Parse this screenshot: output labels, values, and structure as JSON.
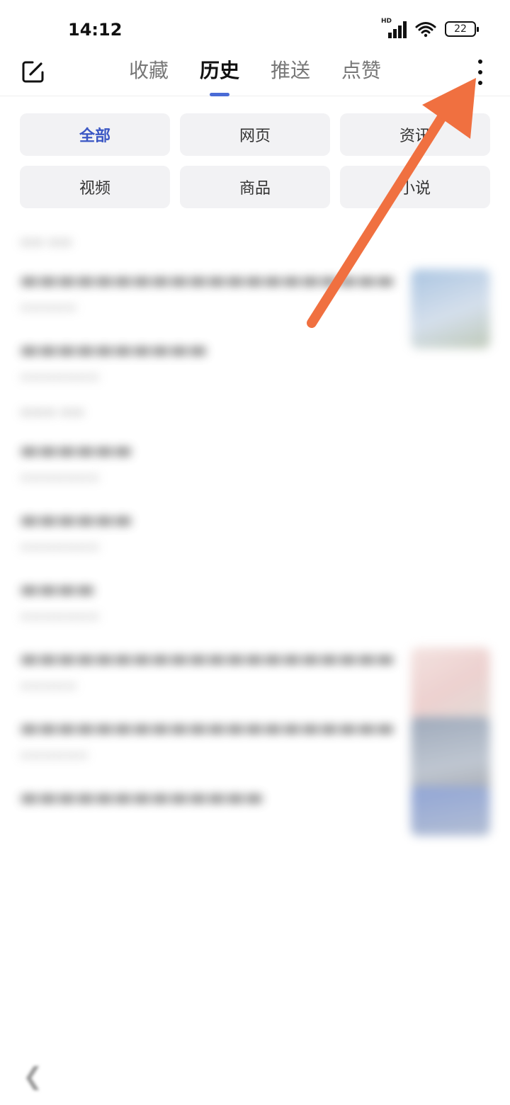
{
  "status_bar": {
    "time": "14:12",
    "network_badge": "HD",
    "battery_level": "22",
    "icons": [
      "signal-icon",
      "wifi-icon",
      "battery-icon"
    ]
  },
  "header": {
    "left_icon": "edit-icon",
    "tabs": [
      {
        "label": "收藏",
        "active": false
      },
      {
        "label": "历史",
        "active": true
      },
      {
        "label": "推送",
        "active": false
      },
      {
        "label": "点赞",
        "active": false
      }
    ],
    "right_icon": "more-vertical-icon",
    "accent_color": "#4a6bd6"
  },
  "filters": [
    {
      "label": "全部",
      "active": true
    },
    {
      "label": "网页",
      "active": false
    },
    {
      "label": "资讯",
      "active": false
    },
    {
      "label": "视频",
      "active": false
    },
    {
      "label": "商品",
      "active": false
    },
    {
      "label": "小说",
      "active": false
    }
  ],
  "annotation": {
    "type": "arrow",
    "color": "#f07040",
    "points_to": "more-vertical-icon"
  }
}
